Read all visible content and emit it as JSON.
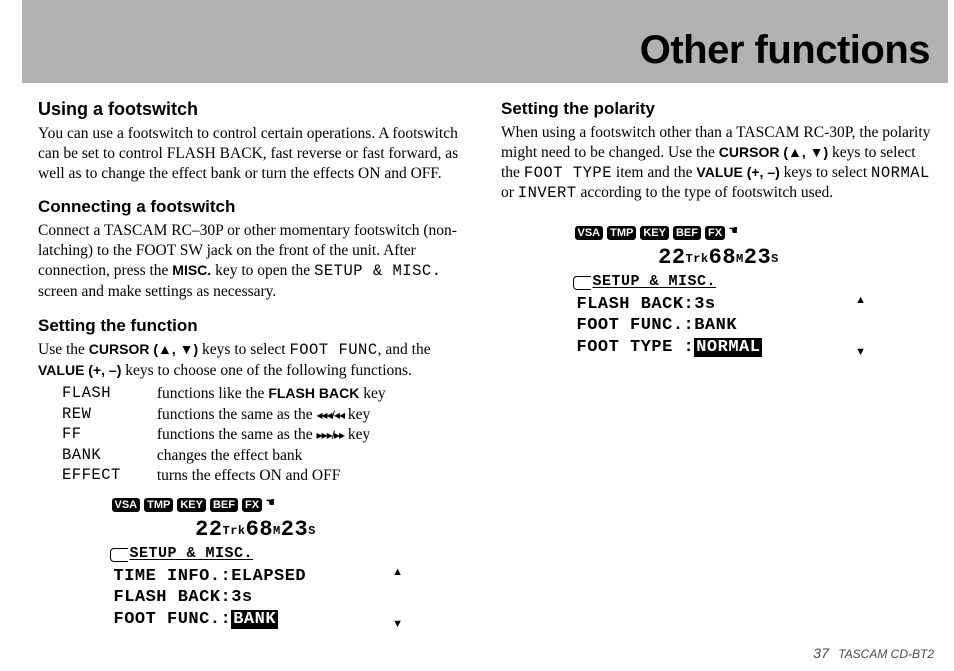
{
  "title": "Other functions",
  "left": {
    "h_using": "Using a footswitch",
    "p_using": "You can use a footswitch to control certain operations. A footswitch can be set to control FLASH BACK, fast reverse or fast forward, as well as to change the effect bank or turn the effects ON and OFF.",
    "h_connect": "Connecting a footswitch",
    "p_connect_a": "Connect a TASCAM RC–30P or other momentary footswitch (non-latching) to the FOOT SW jack on the front of the unit. After connection, press the ",
    "misc_label": "MISC.",
    "p_connect_b": " key to open the ",
    "mono_setup": "SETUP & MISC.",
    "p_connect_c": " screen and make settings as necessary.",
    "h_setfunc": "Setting the function",
    "p_setfunc_a": "Use the ",
    "cursor_label": "CURSOR (▲, ▼)",
    "p_setfunc_b": " keys to select ",
    "mono_footfunc": "FOOT FUNC",
    "p_setfunc_c": ", and the ",
    "value_label": "VALUE (+, –)",
    "p_setfunc_d": " keys to choose one of the following functions.",
    "table": [
      {
        "label": "FLASH",
        "desc_a": "functions like the ",
        "bold": "FLASH BACK",
        "desc_b": " key"
      },
      {
        "label": "REW",
        "desc_a": "functions the same as the ",
        "icons": "◂◂◂/◂◂",
        "desc_b": " key"
      },
      {
        "label": "FF",
        "desc_a": "functions the same as the ",
        "icons": "▸▸▸/▸▸",
        "desc_b": " key"
      },
      {
        "label": "BANK",
        "desc_a": "changes the effect bank",
        "desc_b": ""
      },
      {
        "label": "EFFECT",
        "desc_a": "turns the effects ON and OFF",
        "desc_b": ""
      }
    ],
    "lcd": {
      "tabs": [
        "VSA",
        "TMP",
        "KEY",
        "BEF",
        "FX"
      ],
      "time_tr": "22",
      "time_tr_lbl": "Trk",
      "time_m": "68",
      "time_m_lbl": "M",
      "time_s": "23",
      "time_s_lbl": "S",
      "section": "SETUP & MISC.",
      "lines": [
        "TIME INFO.:ELAPSED",
        "FLASH BACK:3s"
      ],
      "last_label": "FOOT FUNC.:",
      "last_val": "BANK"
    }
  },
  "right": {
    "h_polarity": "Setting the polarity",
    "p_pol_a": "When using a footswitch other than a TASCAM RC-30P, the polarity might need to be changed. Use the ",
    "cursor_label": "CURSOR (▲, ▼)",
    "p_pol_b": " keys to select the ",
    "mono_foottype": "FOOT TYPE",
    "p_pol_c": " item and the ",
    "value_label": "VALUE (+, –)",
    "p_pol_d": " keys to select ",
    "mono_normal": "NORMAL",
    "p_pol_e": " or ",
    "mono_invert": "INVERT",
    "p_pol_f": " according to the type of footswitch used.",
    "lcd": {
      "tabs": [
        "VSA",
        "TMP",
        "KEY",
        "BEF",
        "FX"
      ],
      "time_tr": "22",
      "time_tr_lbl": "Trk",
      "time_m": "68",
      "time_m_lbl": "M",
      "time_s": "23",
      "time_s_lbl": "S",
      "section": "SETUP & MISC.",
      "lines": [
        "FLASH BACK:3s",
        "FOOT FUNC.:BANK"
      ],
      "last_label": "FOOT TYPE :",
      "last_val": "NORMAL"
    }
  },
  "footer": {
    "page": "37",
    "model": "TASCAM  CD-BT2"
  }
}
